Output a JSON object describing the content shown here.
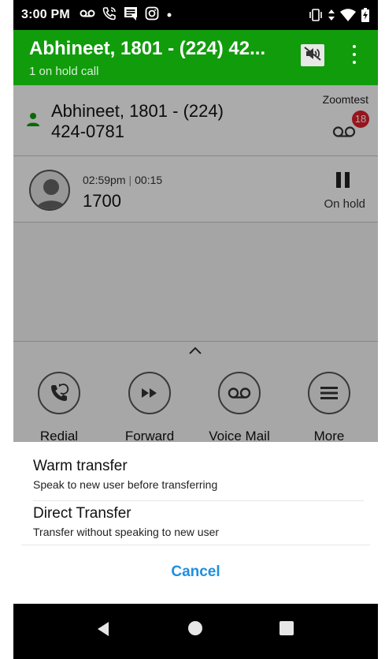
{
  "status_bar": {
    "time": "3:00 PM",
    "left_icons": [
      "voicemail-icon",
      "phone-call-icon",
      "message-icon",
      "instagram-icon",
      "dot-icon"
    ],
    "right_icons": [
      "vibrate-icon",
      "data-arrows-icon",
      "wifi-icon",
      "battery-charging-icon"
    ]
  },
  "app_bar": {
    "title": "Abhineet, 1801 - (224) 42...",
    "subtitle": "1 on hold call",
    "background_color": "#119c0c"
  },
  "contact": {
    "name": "Abhineet, 1801 - (224) 424-0781",
    "tag": "Zoomtest",
    "voicemail_count": "18"
  },
  "call": {
    "start_time": "02:59pm",
    "duration": "00:15",
    "number": "1700",
    "status": "On hold"
  },
  "actions": [
    {
      "label": "Redial",
      "icon": "redial-icon"
    },
    {
      "label": "Forward",
      "icon": "forward-icon"
    },
    {
      "label": "Voice Mail",
      "icon": "voicemail-icon"
    },
    {
      "label": "More",
      "icon": "more-icon"
    }
  ],
  "transfer_sheet": {
    "options": [
      {
        "title": "Warm transfer",
        "description": "Speak to new user before transferring"
      },
      {
        "title": "Direct Transfer",
        "description": "Transfer without speaking to new user"
      }
    ],
    "cancel_label": "Cancel",
    "accent_color": "#1e8fe0"
  },
  "nav_bar": {
    "buttons": [
      "back-icon",
      "home-icon",
      "recents-icon"
    ]
  }
}
